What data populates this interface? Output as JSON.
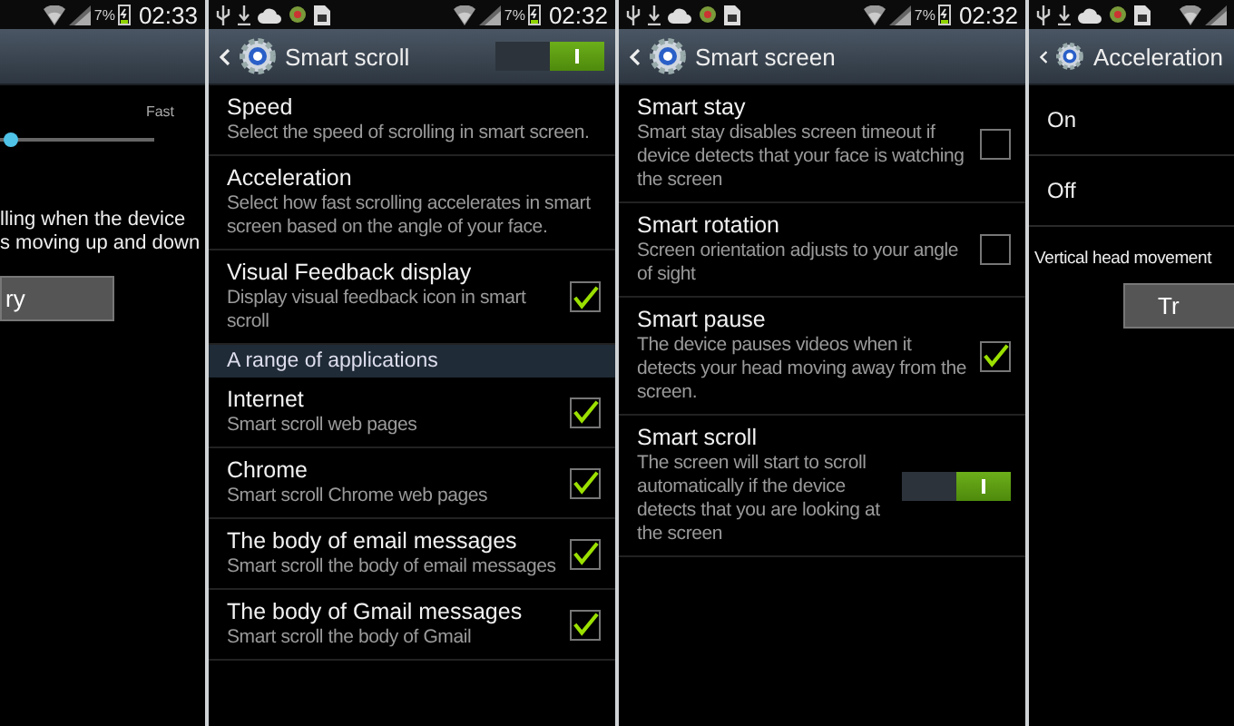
{
  "panels": [
    {
      "kind": "speed",
      "status_bar": {
        "notifications": false,
        "battery": "7%",
        "time": "02:33"
      },
      "slider_label": "Fast",
      "level": 0.02,
      "description": "lling when the device\ns moving up and down",
      "button": "ry"
    },
    {
      "kind": "list",
      "status_bar": {
        "notifications": true,
        "battery": "7%",
        "time": "02:32"
      },
      "title": "Smart scroll",
      "master_switch": {
        "on": true
      },
      "items": [
        {
          "kind": "plain",
          "title": "Speed",
          "summary": "Select the speed of scrolling in smart screen."
        },
        {
          "kind": "plain",
          "title": "Acceleration",
          "summary": "Select how fast scrolling accelerates in smart screen based on the angle of your face."
        },
        {
          "kind": "checkbox",
          "title": "Visual Feedback display",
          "summary": "Display visual feedback icon in smart scroll",
          "checked": true
        },
        {
          "kind": "section",
          "title": "A range of applications"
        },
        {
          "kind": "checkbox",
          "title": "Internet",
          "summary": "Smart scroll web pages",
          "checked": true
        },
        {
          "kind": "checkbox",
          "title": "Chrome",
          "summary": "Smart scroll Chrome web pages",
          "checked": true
        },
        {
          "kind": "checkbox",
          "title": "The body of email messages",
          "summary": "Smart scroll the body of email messages",
          "checked": true
        },
        {
          "kind": "checkbox",
          "title": "The body of Gmail messages",
          "summary": "Smart scroll the body of Gmail",
          "checked": true
        }
      ]
    },
    {
      "kind": "list",
      "status_bar": {
        "notifications": true,
        "battery": "7%",
        "time": "02:32"
      },
      "title": "Smart screen",
      "items": [
        {
          "kind": "checkbox",
          "title": "Smart stay",
          "summary": "Smart stay disables screen timeout if device detects that your face is watching the screen",
          "checked": false
        },
        {
          "kind": "checkbox",
          "title": "Smart rotation",
          "summary": "Screen orientation adjusts to your angle of sight",
          "checked": false
        },
        {
          "kind": "checkbox",
          "title": "Smart pause",
          "summary": "The device pauses videos when it detects your head moving away from the screen.",
          "checked": true
        },
        {
          "kind": "switch",
          "title": "Smart scroll",
          "summary": "The screen will start to scroll automatically if the device detects that you are looking at the screen",
          "checked": true
        }
      ]
    },
    {
      "kind": "acceleration",
      "status_bar": {
        "notifications": true
      },
      "title": "Acceleration",
      "options": [
        "On",
        "Off"
      ],
      "description": "Vertical head movement",
      "button": "Tr"
    }
  ]
}
